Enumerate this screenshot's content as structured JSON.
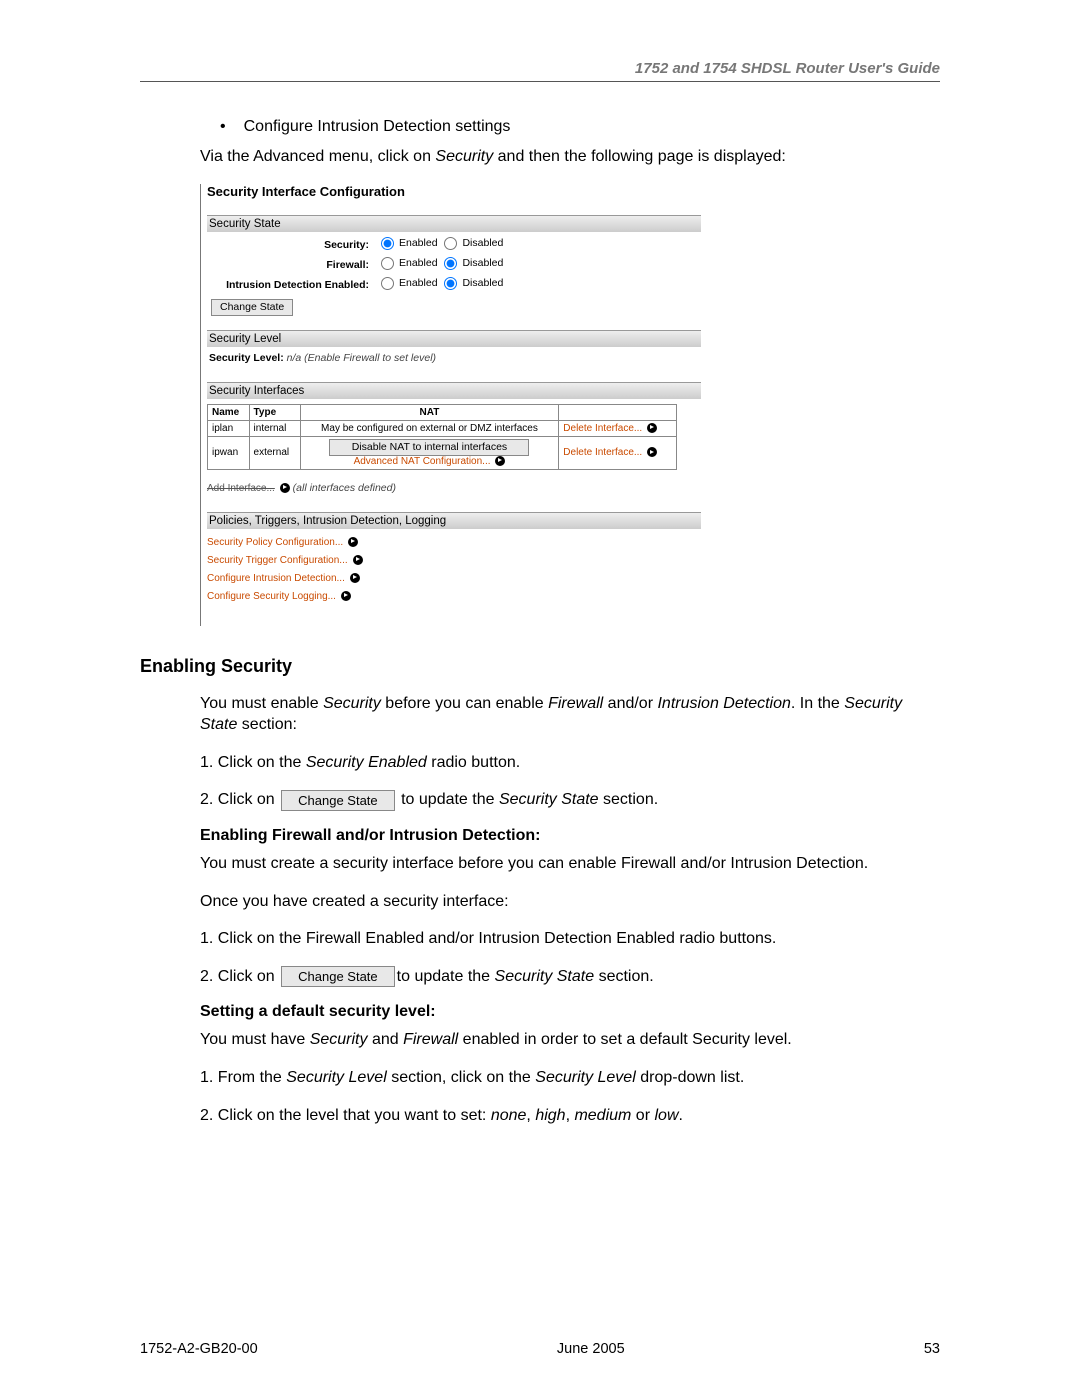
{
  "header": "1752 and 1754 SHDSL Router User's Guide",
  "intro": {
    "bullet": "Configure Intrusion Detection settings",
    "via_pre": "Via the Advanced menu, click on ",
    "via_link": "Security",
    "via_post": " and then the following page is displayed:"
  },
  "panel": {
    "title": "Security Interface Configuration",
    "state_head": "Security State",
    "labels": {
      "security": "Security:",
      "firewall": "Firewall:",
      "ids": "Intrusion Detection Enabled:"
    },
    "opts": {
      "enabled": "Enabled",
      "disabled": "Disabled"
    },
    "change_state_btn": "Change State",
    "level_head": "Security Level",
    "level_label": "Security Level:",
    "level_value": "n/a (Enable Firewall to set level)",
    "ifaces_head": "Security Interfaces",
    "th_name": "Name",
    "th_type": "Type",
    "th_nat": "NAT",
    "rows": [
      {
        "name": "iplan",
        "type": "internal",
        "nat_text": "May be configured on external or DMZ interfaces",
        "delete": "Delete Interface..."
      },
      {
        "name": "ipwan",
        "type": "external",
        "nat_btn": "Disable NAT to internal interfaces",
        "nat_link": "Advanced NAT Configuration...",
        "delete": "Delete Interface..."
      }
    ],
    "add_iface": "Add Interface...",
    "add_iface_note": "(all interfaces defined)",
    "policies_head": "Policies, Triggers, Intrusion Detection, Logging",
    "policies": [
      "Security Policy Configuration...",
      "Security Trigger Configuration...",
      "Configure Intrusion Detection...",
      "Configure Security Logging..."
    ]
  },
  "enabling": {
    "heading": "Enabling Security",
    "p1_pre": "You must enable ",
    "p1_i1": "Security",
    "p1_mid": " before you can enable ",
    "p1_i2": "Firewall",
    "p1_andor": " and/or ",
    "p1_i3": "Intrusion Detection",
    "p1_tail": ". In the ",
    "p1_i4": "Security State",
    "p1_end": " section:",
    "s1_pre": "1. Click on the ",
    "s1_i": "Security Enabled",
    "s1_post": " radio button.",
    "s2_pre": "2. Click on ",
    "change_state_btn": "Change State",
    "s2_mid": " to update the ",
    "s2_i": "Security State",
    "s2_post": " section.",
    "sub1": "Enabling Firewall and/or Intrusion Detection:",
    "p2": "You must create a security interface before you can enable Firewall and/or Intrusion Detection.",
    "p3": "Once you have created a security interface:",
    "s3": "1. Click on the Firewall Enabled and/or Intrusion Detection Enabled radio buttons.",
    "s4_pre": "2. Click on ",
    "s4_mid": "to update the ",
    "s4_i": "Security State",
    "s4_post": " section.",
    "sub2": "Setting a default security level:",
    "p4_pre": "You must have ",
    "p4_i1": "Security",
    "p4_and": " and ",
    "p4_i2": "Firewall",
    "p4_post": " enabled in order to set a default Security level.",
    "s5_pre": "1. From the ",
    "s5_i1": "Security Level",
    "s5_mid": " section, click on the ",
    "s5_i2": "Security Level",
    "s5_post": " drop-down list.",
    "s6_pre": "2. Click on the level that you want to set: ",
    "s6_i1": "none",
    "s6_c": ", ",
    "s6_i2": "high",
    "s6_i3": "medium",
    "s6_or": " or ",
    "s6_i4": "low",
    "s6_end": "."
  },
  "footer": {
    "left": "1752-A2-GB20-00",
    "center": "June 2005",
    "right": "53"
  }
}
